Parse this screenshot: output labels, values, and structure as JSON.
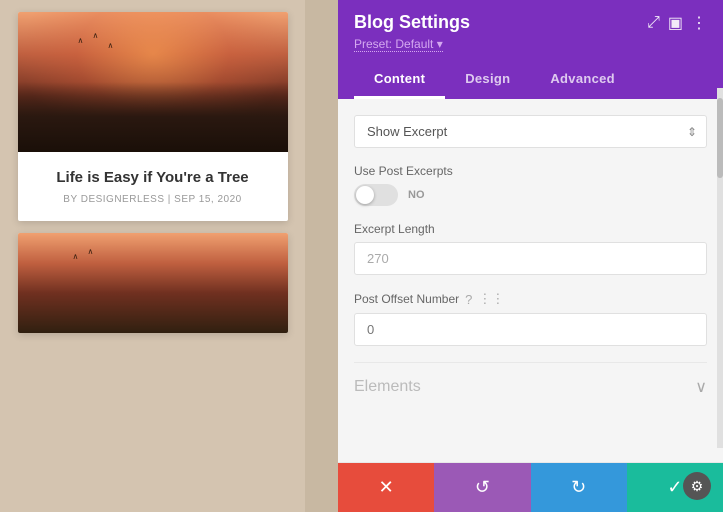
{
  "panel": {
    "title": "Blog Settings",
    "preset_label": "Preset: Default",
    "preset_arrow": "▾",
    "tabs": [
      {
        "id": "content",
        "label": "Content",
        "active": true
      },
      {
        "id": "design",
        "label": "Design",
        "active": false
      },
      {
        "id": "advanced",
        "label": "Advanced",
        "active": false
      }
    ],
    "header_icons": {
      "resize_icon": "⤢",
      "layout_icon": "▣",
      "more_icon": "⋮"
    }
  },
  "content": {
    "show_excerpt_label": "Show Excerpt",
    "show_excerpt_options": [
      "Show Excerpt"
    ],
    "use_post_excerpts_label": "Use Post Excerpts",
    "toggle_state": "NO",
    "excerpt_length_label": "Excerpt Length",
    "excerpt_length_value": "270",
    "excerpt_length_placeholder": "270",
    "post_offset_label": "Post Offset Number",
    "post_offset_value": "0",
    "post_offset_placeholder": "0"
  },
  "elements_section": {
    "label": "Elements"
  },
  "toolbar": {
    "cancel_icon": "✕",
    "undo_icon": "↺",
    "redo_icon": "↻",
    "save_icon": "✓"
  },
  "blog_card": {
    "title": "Life is Easy if You're a Tree",
    "meta": "BY DESIGNERLESS | SEP 15, 2020"
  },
  "colors": {
    "purple": "#7b2fbe",
    "tab_active_border": "#ffffff",
    "cancel_red": "#e74c3c",
    "undo_purple": "#9b59b6",
    "redo_blue": "#3498db",
    "save_teal": "#1abc9c"
  }
}
